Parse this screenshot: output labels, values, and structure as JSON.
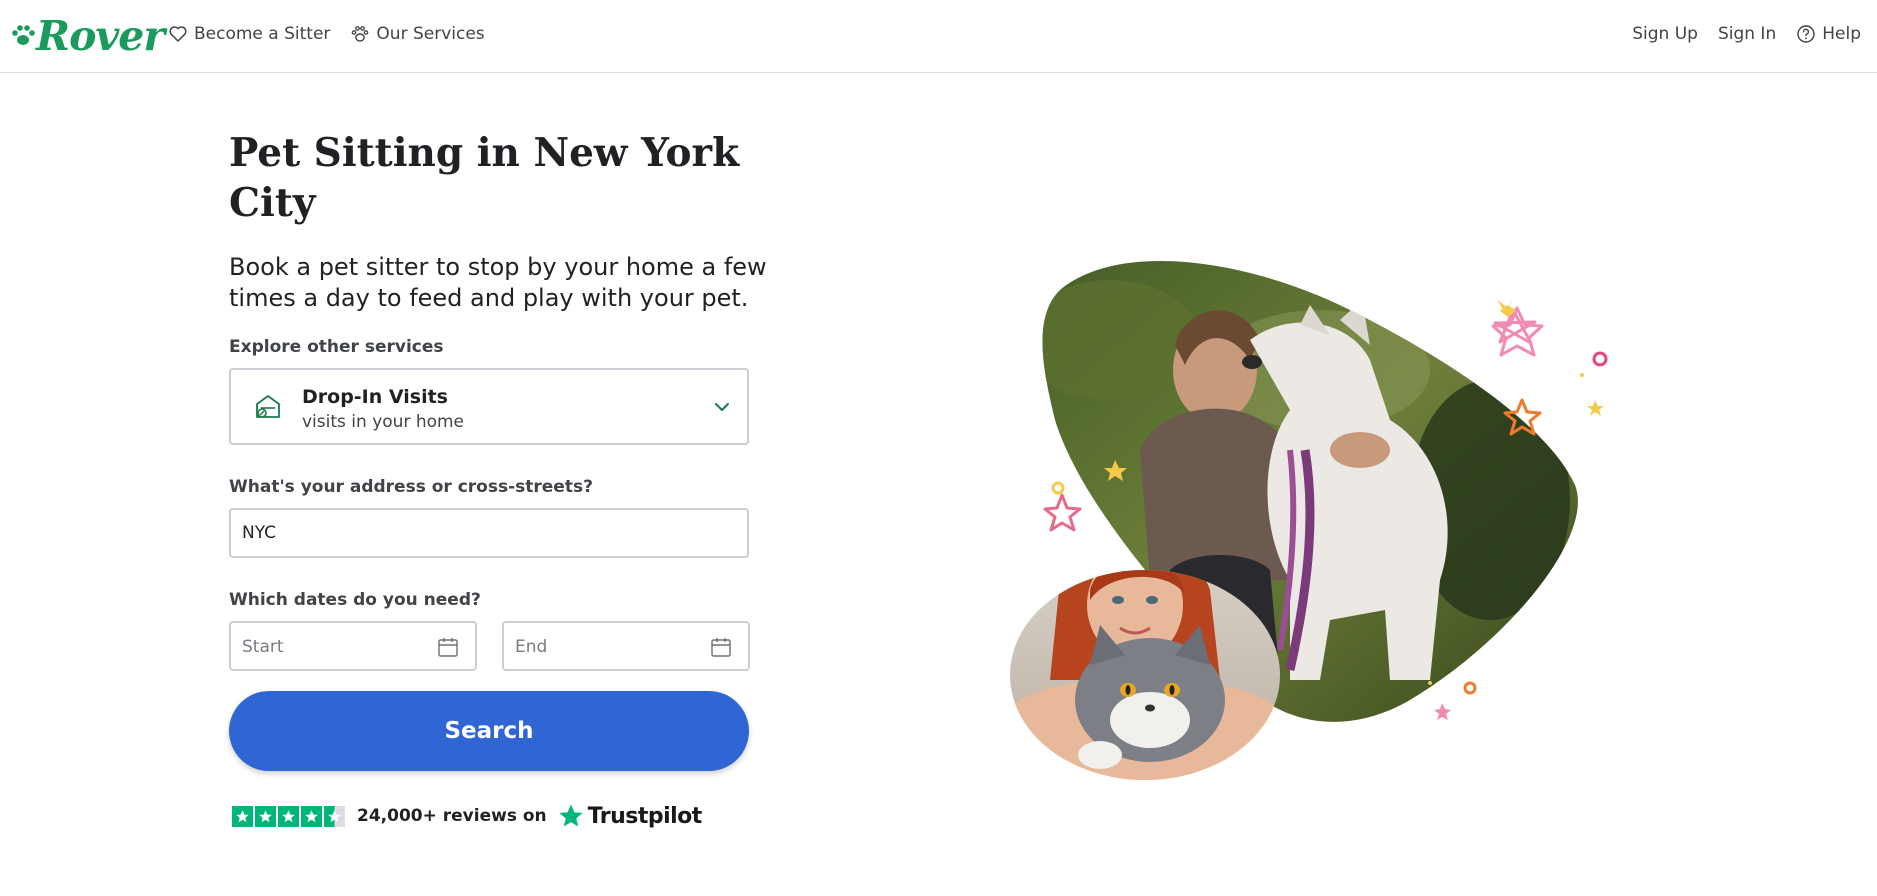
{
  "header": {
    "logo_text": "Rover",
    "nav_left": [
      {
        "label": "Become a Sitter",
        "icon": "heart-icon"
      },
      {
        "label": "Our Services",
        "icon": "paw-icon"
      }
    ],
    "nav_right": [
      {
        "label": "Sign Up"
      },
      {
        "label": "Sign In"
      },
      {
        "label": "Help",
        "icon": "help-icon"
      }
    ]
  },
  "main": {
    "title": "Pet Sitting in New York City",
    "subtitle": "Book a pet sitter to stop by your home a few times a day to feed and play with your pet.",
    "explore_label": "Explore other services",
    "service": {
      "title": "Drop-In Visits",
      "subtitle": "visits in your home",
      "icon": "house-icon"
    },
    "address_label": "What's your address or cross-streets?",
    "address_value": "NYC",
    "dates_label": "Which dates do you need?",
    "start_placeholder": "Start",
    "end_placeholder": "End",
    "search_label": "Search",
    "reviews_text": "24,000+ reviews on",
    "trustpilot_text": "Trustpilot",
    "trustpilot_rating": 4.5
  },
  "colors": {
    "brand_green": "#1a9a5b",
    "search_blue": "#2f66d4",
    "trustpilot_green": "#00b67a"
  }
}
